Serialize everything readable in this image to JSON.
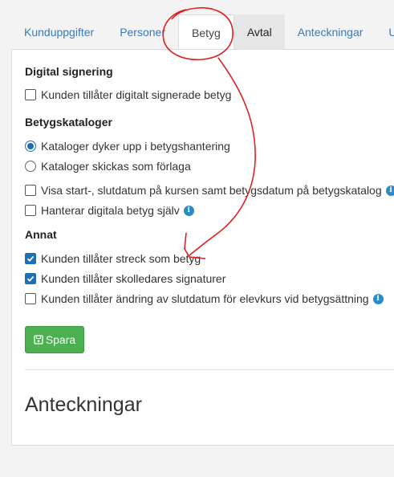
{
  "tabs": [
    {
      "label": "Kunduppgifter"
    },
    {
      "label": "Personer"
    },
    {
      "label": "Betyg"
    },
    {
      "label": "Avtal"
    },
    {
      "label": "Anteckningar"
    },
    {
      "label": "Ut"
    }
  ],
  "active_tab": "Betyg",
  "digital": {
    "title": "Digital signering",
    "options": [
      {
        "label": "Kunden tillåter digitalt signerade betyg",
        "checked": false
      }
    ]
  },
  "catalogs": {
    "title": "Betygskataloger",
    "radios": [
      {
        "label": "Kataloger dyker upp i betygshantering",
        "selected": true
      },
      {
        "label": "Kataloger skickas som förlaga",
        "selected": false
      }
    ],
    "options": [
      {
        "label": "Visa start-, slutdatum på kursen samt betygsdatum på betygskatalog",
        "checked": false,
        "info": true
      },
      {
        "label": "Hanterar digitala betyg själv",
        "checked": false,
        "info": true
      }
    ]
  },
  "other": {
    "title": "Annat",
    "options": [
      {
        "label": "Kunden tillåter streck som betyg",
        "checked": true
      },
      {
        "label": "Kunden tillåter skolledares signaturer",
        "checked": true
      },
      {
        "label": "Kunden tillåter ändring av slutdatum för elevkurs vid betygsättning",
        "checked": false,
        "info": true
      }
    ]
  },
  "save_button": {
    "label": "Spara",
    "color": "#4caf50"
  },
  "notes_heading": "Anteckningar",
  "colors": {
    "accent": "#1f6fb8",
    "link": "#3a7ab8",
    "annotation": "#e02020"
  }
}
